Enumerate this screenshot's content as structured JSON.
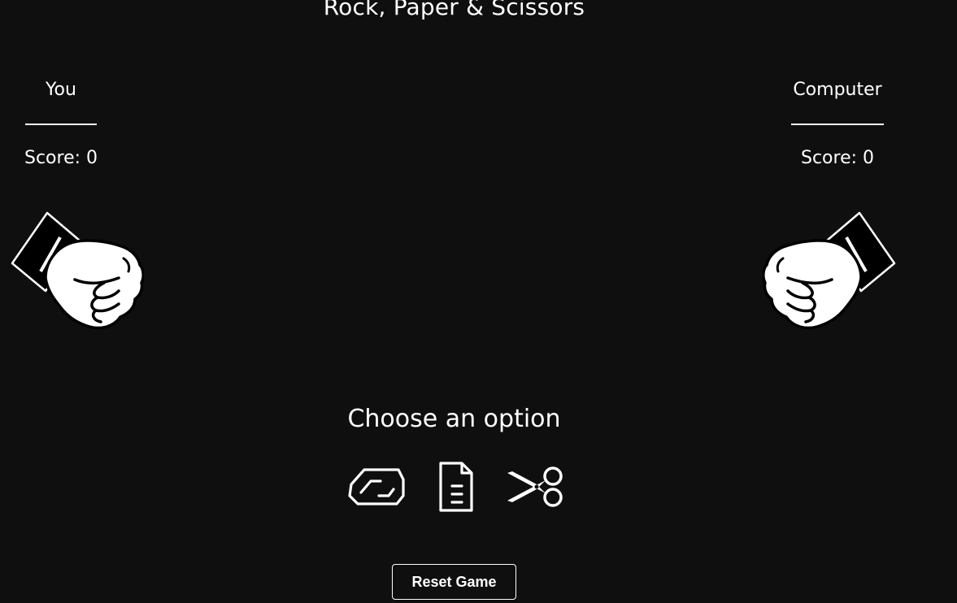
{
  "game": {
    "title": "Rock, Paper & Scissors",
    "prompt": "Choose an option",
    "reset_label": "Reset Game"
  },
  "players": {
    "you": {
      "name": "You",
      "score_text": "Score: 0"
    },
    "computer": {
      "name": "Computer",
      "score_text": "Score: 0"
    }
  },
  "hands": {
    "you": "fist-rock-icon",
    "computer": "fist-rock-icon"
  },
  "options": [
    {
      "id": "rock",
      "icon": "rock-icon"
    },
    {
      "id": "paper",
      "icon": "paper-icon"
    },
    {
      "id": "scissors",
      "icon": "scissors-icon"
    }
  ],
  "colors": {
    "background": "#0f0f0f",
    "foreground": "#ffffff"
  }
}
